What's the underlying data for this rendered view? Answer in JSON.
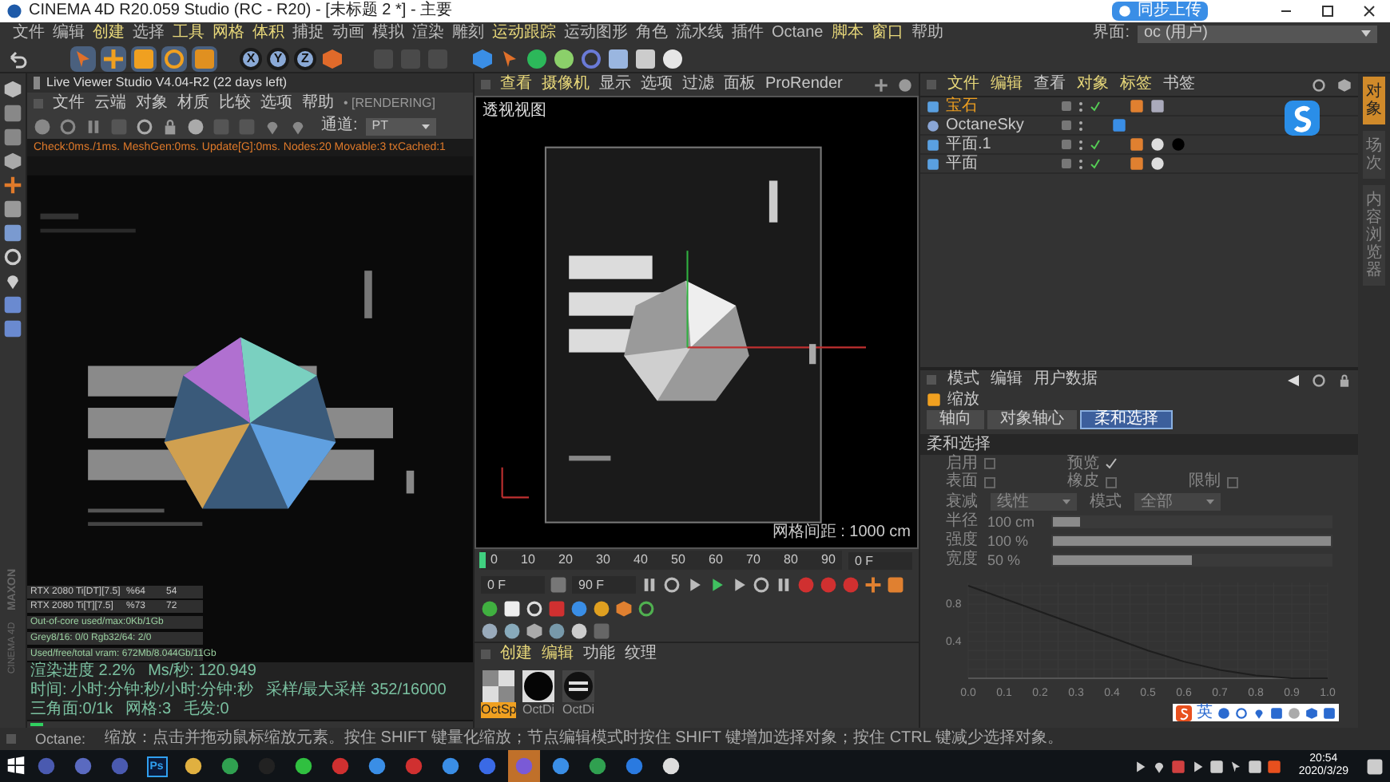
{
  "window": {
    "title": "CINEMA 4D R20.059 Studio (RC - R20) - [未标题 2 *] - 主要",
    "upload_badge": "同步上传"
  },
  "menu": [
    "文件",
    "编辑",
    "创建",
    "选择",
    "工具",
    "网格",
    "体积",
    "捕捉",
    "动画",
    "模拟",
    "渲染",
    "雕刻",
    "运动跟踪",
    "运动图形",
    "角色",
    "流水线",
    "插件",
    "Octane",
    "脚本",
    "窗口",
    "帮助"
  ],
  "layout": {
    "label": "界面:",
    "value": "oc (用户)"
  },
  "toolbar": {
    "axes": [
      "X",
      "Y",
      "Z"
    ]
  },
  "side_logo": [
    "MAXON",
    "CINEMA 4D"
  ],
  "live_viewer": {
    "title": "Live Viewer Studio V4.04-R2 (22 days left)",
    "menu": [
      "文件",
      "云端",
      "对象",
      "材质",
      "比较",
      "选项",
      "帮助"
    ],
    "state": "• [RENDERING]",
    "channel": {
      "label": "通道:",
      "value": "PT"
    },
    "log": "Check:0ms./1ms. MeshGen:0ms. Update[G]:0ms. Nodes:20 Movable:3 txCached:1",
    "render": {
      "kind": "picture"
    },
    "gpus": [
      {
        "name": "RTX 2080 Ti[DT][7.5]",
        "load": "%64",
        "temp": "54"
      },
      {
        "name": "RTX 2080 Ti[T][7.5]",
        "load": "%73",
        "temp": "72"
      }
    ],
    "memory": [
      "Out-of-core used/max:0Kb/1Gb",
      "Grey8/16: 0/0   Rgb32/64: 2/0",
      "Used/free/total vram: 672Mb/8.044Gb/11Gb"
    ],
    "stats": [
      "渲染进度 2.2%",
      "Ms/秒: 120.949",
      "时间: 小时:分钟:秒/小时:分钟:秒",
      "采样/最大采样 352/16000",
      "三角面:0/1k",
      "网格:3",
      "毛发:0"
    ],
    "progress": {
      "level": 0.03
    }
  },
  "viewport": {
    "menu": [
      "查看",
      "摄像机",
      "显示",
      "选项",
      "过滤",
      "面板",
      "ProRender"
    ],
    "label": "透视视图",
    "scene": {
      "kind": "picture"
    },
    "grid_spacing": "网格间距 : 1000 cm"
  },
  "timeline": {
    "ticks": [
      "0",
      "10",
      "20",
      "30",
      "40",
      "50",
      "60",
      "70",
      "80",
      "90"
    ],
    "playhead": {
      "level": 0
    },
    "frame": "0 F"
  },
  "transport": {
    "start": "0 F",
    "end": "90 F"
  },
  "materials": {
    "menu": [
      "创建",
      "编辑",
      "功能",
      "纹理"
    ],
    "items": [
      {
        "name": "OctSp",
        "kind": "checker",
        "selected": true
      },
      {
        "name": "OctDi",
        "kind": "black",
        "selected": false
      },
      {
        "name": "OctDi",
        "kind": "text",
        "selected": false
      }
    ]
  },
  "objects": {
    "menu": [
      "文件",
      "编辑",
      "查看",
      "对象",
      "标签",
      "书签"
    ],
    "items": [
      {
        "name": "宝石",
        "selected": true
      },
      {
        "name": "OctaneSky",
        "selected": false
      },
      {
        "name": "平面.1",
        "selected": false
      },
      {
        "name": "平面",
        "selected": false
      }
    ]
  },
  "side_tabs": [
    {
      "label": "对象",
      "selected": true
    },
    {
      "label": "场次",
      "selected": false
    },
    {
      "label": "内容浏览器",
      "selected": false
    }
  ],
  "attributes": {
    "menu": [
      "模式",
      "编辑",
      "用户数据"
    ],
    "tool": "缩放",
    "tabs": [
      {
        "label": "轴向",
        "selected": false
      },
      {
        "label": "对象轴心",
        "selected": false
      },
      {
        "label": "柔和选择",
        "selected": true
      }
    ],
    "section": "柔和选择",
    "checks": [
      [
        {
          "label": "启用",
          "checked": false
        },
        {
          "label": "预览",
          "checked": true
        }
      ],
      [
        {
          "label": "表面",
          "checked": false
        },
        {
          "label": "橡皮",
          "checked": false
        },
        {
          "label": "限制",
          "checked": false
        }
      ]
    ],
    "dropdowns": [
      {
        "label": "衰减",
        "value": "线性"
      },
      {
        "label": "模式",
        "value": "全部"
      }
    ],
    "sliders": [
      {
        "label": "半径",
        "value": "100 cm",
        "level": 0.1
      },
      {
        "label": "强度",
        "value": "100 %",
        "level": 1
      },
      {
        "label": "宽度",
        "value": "50 %",
        "level": 0.5
      }
    ],
    "chart_data": {
      "type": "line",
      "x": [
        0,
        0.1,
        0.2,
        0.3,
        0.4,
        0.5,
        0.6,
        0.7,
        0.8,
        0.9,
        1
      ],
      "series": [
        {
          "color": "#1e1e1e",
          "values": [
            1,
            0.86,
            0.72,
            0.58,
            0.44,
            0.3,
            0.18,
            0.09,
            0.03,
            0,
            0
          ]
        }
      ],
      "xlim": [
        0,
        1
      ],
      "ylim": [
        0,
        1
      ],
      "xticks": [
        {
          "value": 0,
          "label": "0.0"
        },
        0.1,
        0.2,
        0.3,
        0.4,
        0.5,
        0.6,
        0.7,
        0.8,
        0.9,
        {
          "value": 1,
          "label": "1.0"
        }
      ],
      "yticks": [
        0.4,
        0.8
      ]
    }
  },
  "ime_bar": {
    "mode": "英"
  },
  "status_bar": {
    "label": "Octane:",
    "message": "缩放：点击并拖动鼠标缩放元素。按住 SHIFT 键量化缩放；节点编辑模式时按住 SHIFT 键增加选择对象；按住 CTRL 键减少选择对象。"
  },
  "taskbar": {
    "ps_label": "Ps",
    "time": "20:54",
    "date": "2020/3/29"
  }
}
